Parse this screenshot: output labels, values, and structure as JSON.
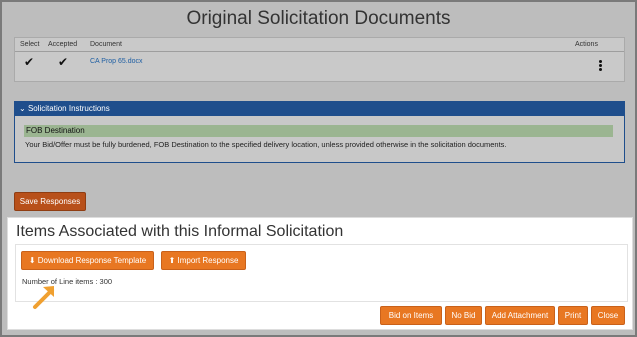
{
  "page": {
    "title": "Original Solicitation Documents"
  },
  "documents": {
    "columns": [
      "Select",
      "Accepted",
      "Document",
      "Actions"
    ],
    "rows": [
      {
        "select": "✔",
        "accepted": "✔",
        "document": "CA Prop 65.docx"
      }
    ]
  },
  "instructions": {
    "header": "Solicitation Instructions",
    "subheader": "FOB Destination",
    "text": "Your Bid/Offer must be fully burdened, FOB Destination to the specified delivery location, unless provided otherwise in the solicitation documents."
  },
  "save_button": "Save Responses",
  "items": {
    "title": "Items Associated with this Informal Solicitation",
    "download_label": "Download Response Template",
    "import_label": "Import Response",
    "line_count_text": "Number of Line items : 300"
  },
  "footer_buttons": {
    "bid": "Bid on Items",
    "no_bid": "No Bid",
    "add_attachment": "Add Attachment",
    "print": "Print",
    "close": "Close"
  },
  "colors": {
    "accent_orange": "#e87722",
    "header_blue": "#1f4e8c",
    "highlight_green": "#9bb591"
  }
}
